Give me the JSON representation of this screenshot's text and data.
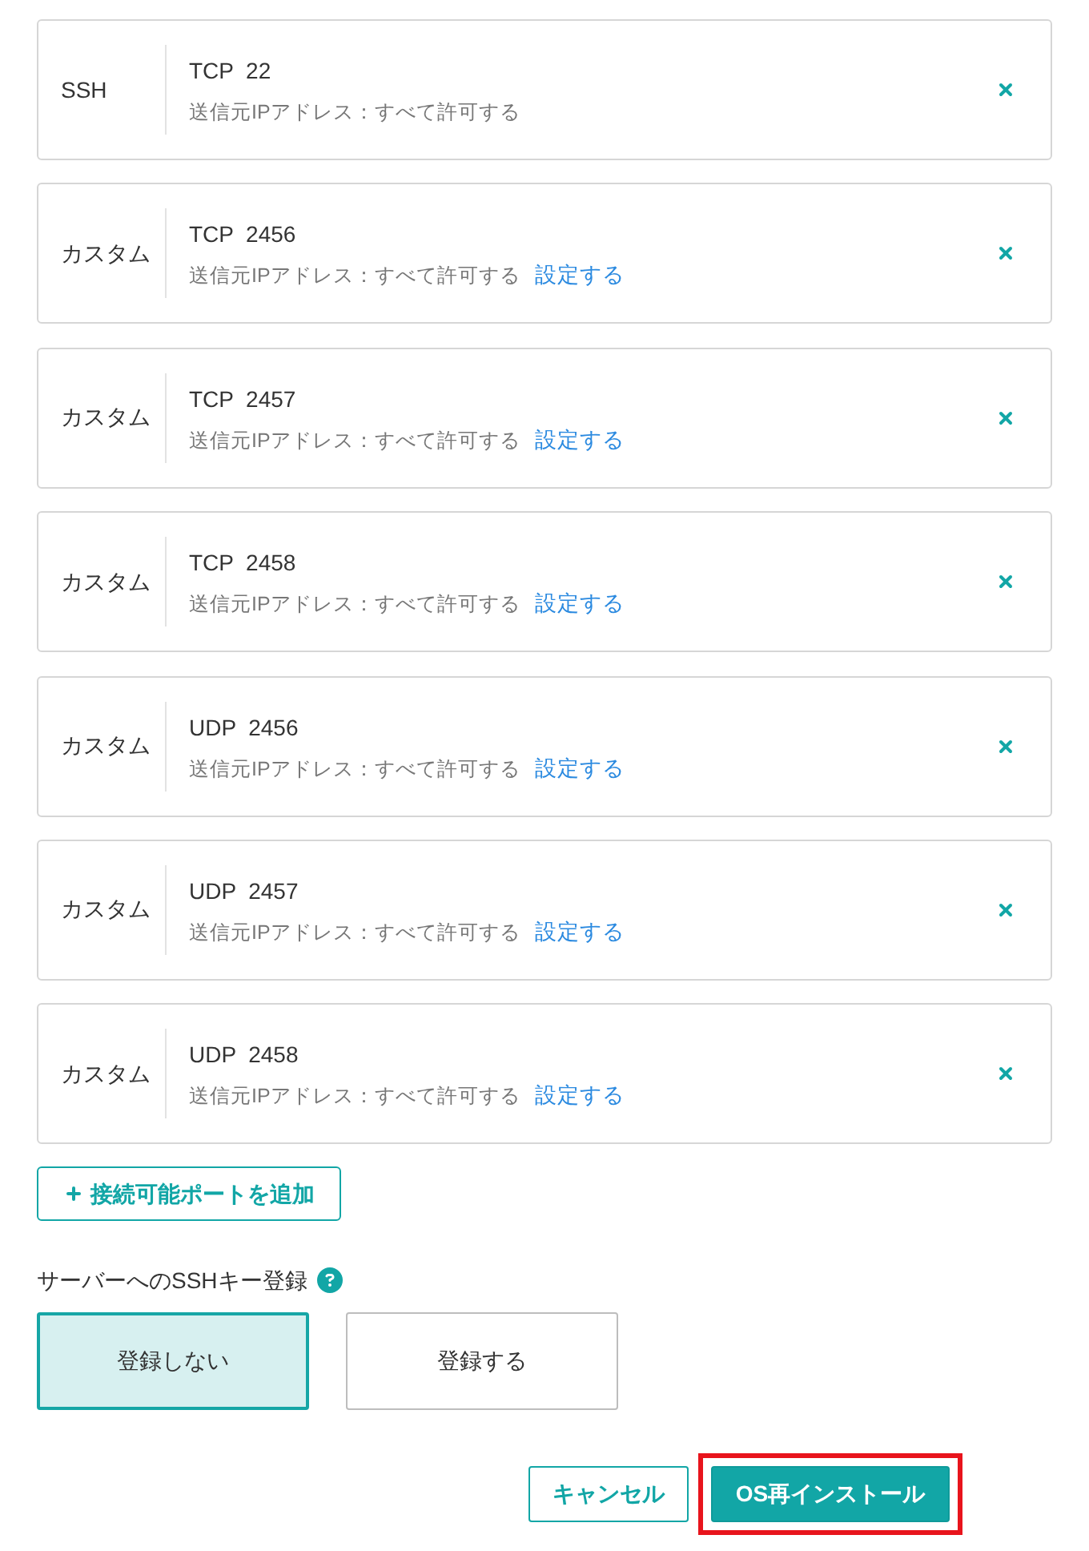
{
  "port_rules": [
    {
      "type": "SSH",
      "protocol": "TCP",
      "port": "22",
      "source": "送信元IPアドレス：すべて許可する"
    },
    {
      "type": "カスタム",
      "protocol": "TCP",
      "port": "2456",
      "source": "送信元IPアドレス：すべて許可する",
      "link": "設定する"
    },
    {
      "type": "カスタム",
      "protocol": "TCP",
      "port": "2457",
      "source": "送信元IPアドレス：すべて許可する",
      "link": "設定する"
    },
    {
      "type": "カスタム",
      "protocol": "TCP",
      "port": "2458",
      "source": "送信元IPアドレス：すべて許可する",
      "link": "設定する"
    },
    {
      "type": "カスタム",
      "protocol": "UDP",
      "port": "2456",
      "source": "送信元IPアドレス：すべて許可する",
      "link": "設定する"
    },
    {
      "type": "カスタム",
      "protocol": "UDP",
      "port": "2457",
      "source": "送信元IPアドレス：すべて許可する",
      "link": "設定する"
    },
    {
      "type": "カスタム",
      "protocol": "UDP",
      "port": "2458",
      "source": "送信元IPアドレス：すべて許可する",
      "link": "設定する"
    }
  ],
  "add_button": {
    "label": "接続可能ポートを追加"
  },
  "ssh_key": {
    "label": "サーバーへのSSHキー登録",
    "options": [
      {
        "label": "登録しない",
        "selected": true
      },
      {
        "label": "登録する",
        "selected": false
      }
    ]
  },
  "actions": [
    {
      "kind": "secondary",
      "label": "キャンセル",
      "highlighted": false
    },
    {
      "kind": "primary",
      "label": "OS再インストール",
      "highlighted": true
    }
  ]
}
